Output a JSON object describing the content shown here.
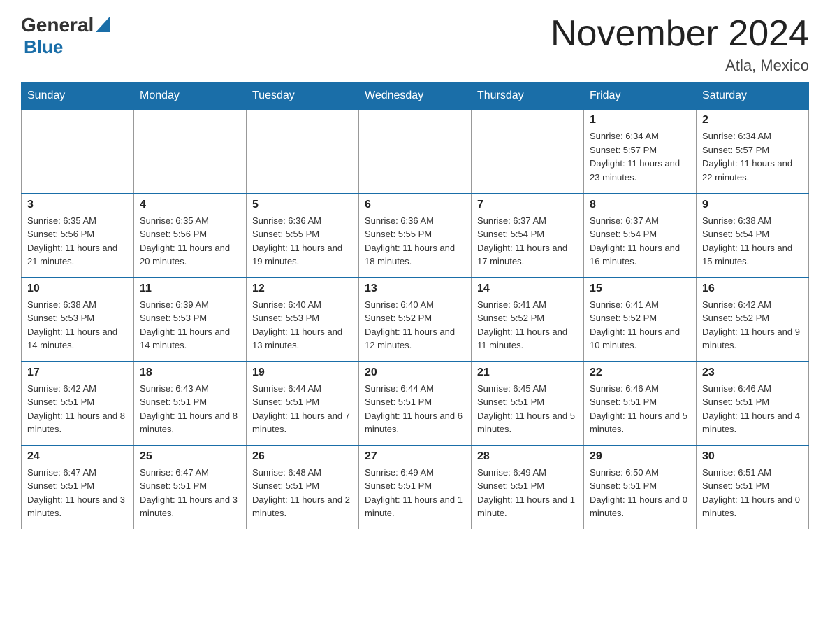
{
  "header": {
    "title": "November 2024",
    "location": "Atla, Mexico",
    "logo_general": "General",
    "logo_blue": "Blue"
  },
  "weekdays": [
    "Sunday",
    "Monday",
    "Tuesday",
    "Wednesday",
    "Thursday",
    "Friday",
    "Saturday"
  ],
  "weeks": [
    [
      {
        "day": "",
        "sunrise": "",
        "sunset": "",
        "daylight": ""
      },
      {
        "day": "",
        "sunrise": "",
        "sunset": "",
        "daylight": ""
      },
      {
        "day": "",
        "sunrise": "",
        "sunset": "",
        "daylight": ""
      },
      {
        "day": "",
        "sunrise": "",
        "sunset": "",
        "daylight": ""
      },
      {
        "day": "",
        "sunrise": "",
        "sunset": "",
        "daylight": ""
      },
      {
        "day": "1",
        "sunrise": "Sunrise: 6:34 AM",
        "sunset": "Sunset: 5:57 PM",
        "daylight": "Daylight: 11 hours and 23 minutes."
      },
      {
        "day": "2",
        "sunrise": "Sunrise: 6:34 AM",
        "sunset": "Sunset: 5:57 PM",
        "daylight": "Daylight: 11 hours and 22 minutes."
      }
    ],
    [
      {
        "day": "3",
        "sunrise": "Sunrise: 6:35 AM",
        "sunset": "Sunset: 5:56 PM",
        "daylight": "Daylight: 11 hours and 21 minutes."
      },
      {
        "day": "4",
        "sunrise": "Sunrise: 6:35 AM",
        "sunset": "Sunset: 5:56 PM",
        "daylight": "Daylight: 11 hours and 20 minutes."
      },
      {
        "day": "5",
        "sunrise": "Sunrise: 6:36 AM",
        "sunset": "Sunset: 5:55 PM",
        "daylight": "Daylight: 11 hours and 19 minutes."
      },
      {
        "day": "6",
        "sunrise": "Sunrise: 6:36 AM",
        "sunset": "Sunset: 5:55 PM",
        "daylight": "Daylight: 11 hours and 18 minutes."
      },
      {
        "day": "7",
        "sunrise": "Sunrise: 6:37 AM",
        "sunset": "Sunset: 5:54 PM",
        "daylight": "Daylight: 11 hours and 17 minutes."
      },
      {
        "day": "8",
        "sunrise": "Sunrise: 6:37 AM",
        "sunset": "Sunset: 5:54 PM",
        "daylight": "Daylight: 11 hours and 16 minutes."
      },
      {
        "day": "9",
        "sunrise": "Sunrise: 6:38 AM",
        "sunset": "Sunset: 5:54 PM",
        "daylight": "Daylight: 11 hours and 15 minutes."
      }
    ],
    [
      {
        "day": "10",
        "sunrise": "Sunrise: 6:38 AM",
        "sunset": "Sunset: 5:53 PM",
        "daylight": "Daylight: 11 hours and 14 minutes."
      },
      {
        "day": "11",
        "sunrise": "Sunrise: 6:39 AM",
        "sunset": "Sunset: 5:53 PM",
        "daylight": "Daylight: 11 hours and 14 minutes."
      },
      {
        "day": "12",
        "sunrise": "Sunrise: 6:40 AM",
        "sunset": "Sunset: 5:53 PM",
        "daylight": "Daylight: 11 hours and 13 minutes."
      },
      {
        "day": "13",
        "sunrise": "Sunrise: 6:40 AM",
        "sunset": "Sunset: 5:52 PM",
        "daylight": "Daylight: 11 hours and 12 minutes."
      },
      {
        "day": "14",
        "sunrise": "Sunrise: 6:41 AM",
        "sunset": "Sunset: 5:52 PM",
        "daylight": "Daylight: 11 hours and 11 minutes."
      },
      {
        "day": "15",
        "sunrise": "Sunrise: 6:41 AM",
        "sunset": "Sunset: 5:52 PM",
        "daylight": "Daylight: 11 hours and 10 minutes."
      },
      {
        "day": "16",
        "sunrise": "Sunrise: 6:42 AM",
        "sunset": "Sunset: 5:52 PM",
        "daylight": "Daylight: 11 hours and 9 minutes."
      }
    ],
    [
      {
        "day": "17",
        "sunrise": "Sunrise: 6:42 AM",
        "sunset": "Sunset: 5:51 PM",
        "daylight": "Daylight: 11 hours and 8 minutes."
      },
      {
        "day": "18",
        "sunrise": "Sunrise: 6:43 AM",
        "sunset": "Sunset: 5:51 PM",
        "daylight": "Daylight: 11 hours and 8 minutes."
      },
      {
        "day": "19",
        "sunrise": "Sunrise: 6:44 AM",
        "sunset": "Sunset: 5:51 PM",
        "daylight": "Daylight: 11 hours and 7 minutes."
      },
      {
        "day": "20",
        "sunrise": "Sunrise: 6:44 AM",
        "sunset": "Sunset: 5:51 PM",
        "daylight": "Daylight: 11 hours and 6 minutes."
      },
      {
        "day": "21",
        "sunrise": "Sunrise: 6:45 AM",
        "sunset": "Sunset: 5:51 PM",
        "daylight": "Daylight: 11 hours and 5 minutes."
      },
      {
        "day": "22",
        "sunrise": "Sunrise: 6:46 AM",
        "sunset": "Sunset: 5:51 PM",
        "daylight": "Daylight: 11 hours and 5 minutes."
      },
      {
        "day": "23",
        "sunrise": "Sunrise: 6:46 AM",
        "sunset": "Sunset: 5:51 PM",
        "daylight": "Daylight: 11 hours and 4 minutes."
      }
    ],
    [
      {
        "day": "24",
        "sunrise": "Sunrise: 6:47 AM",
        "sunset": "Sunset: 5:51 PM",
        "daylight": "Daylight: 11 hours and 3 minutes."
      },
      {
        "day": "25",
        "sunrise": "Sunrise: 6:47 AM",
        "sunset": "Sunset: 5:51 PM",
        "daylight": "Daylight: 11 hours and 3 minutes."
      },
      {
        "day": "26",
        "sunrise": "Sunrise: 6:48 AM",
        "sunset": "Sunset: 5:51 PM",
        "daylight": "Daylight: 11 hours and 2 minutes."
      },
      {
        "day": "27",
        "sunrise": "Sunrise: 6:49 AM",
        "sunset": "Sunset: 5:51 PM",
        "daylight": "Daylight: 11 hours and 1 minute."
      },
      {
        "day": "28",
        "sunrise": "Sunrise: 6:49 AM",
        "sunset": "Sunset: 5:51 PM",
        "daylight": "Daylight: 11 hours and 1 minute."
      },
      {
        "day": "29",
        "sunrise": "Sunrise: 6:50 AM",
        "sunset": "Sunset: 5:51 PM",
        "daylight": "Daylight: 11 hours and 0 minutes."
      },
      {
        "day": "30",
        "sunrise": "Sunrise: 6:51 AM",
        "sunset": "Sunset: 5:51 PM",
        "daylight": "Daylight: 11 hours and 0 minutes."
      }
    ]
  ]
}
